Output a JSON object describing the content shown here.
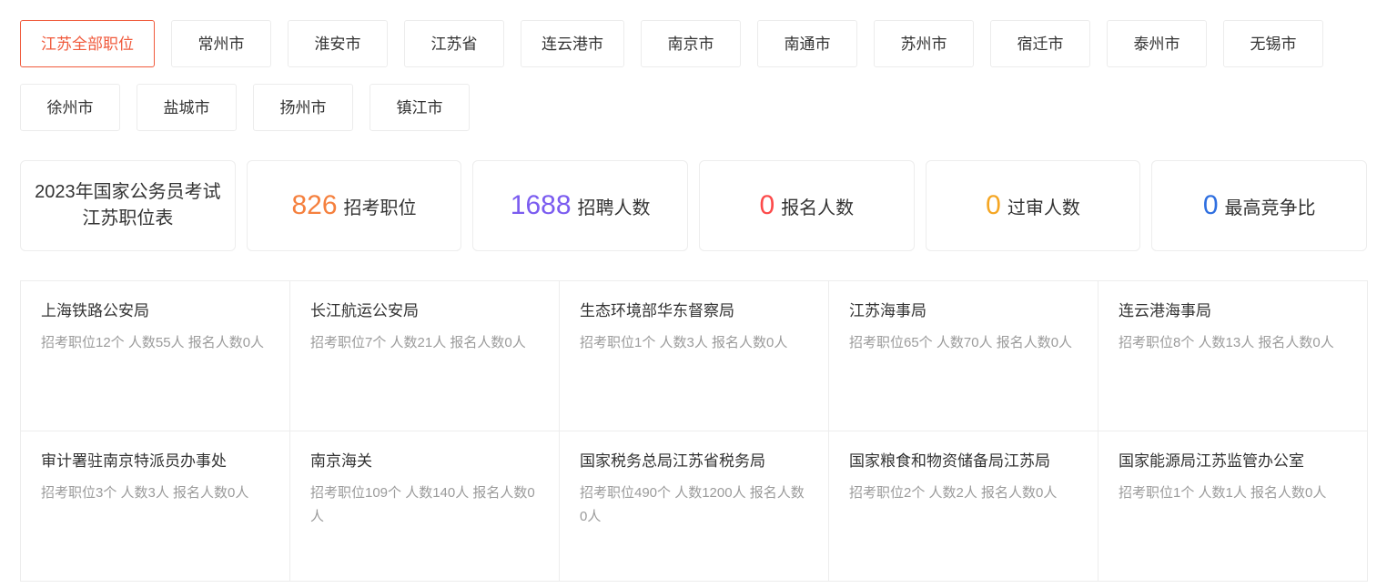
{
  "tabs": {
    "active_index": 0,
    "items": [
      {
        "label": "江苏全部职位",
        "active": true
      },
      {
        "label": "常州市",
        "active": false
      },
      {
        "label": "淮安市",
        "active": false
      },
      {
        "label": "江苏省",
        "active": false
      },
      {
        "label": "连云港市",
        "active": false
      },
      {
        "label": "南京市",
        "active": false
      },
      {
        "label": "南通市",
        "active": false
      },
      {
        "label": "苏州市",
        "active": false
      },
      {
        "label": "宿迁市",
        "active": false
      },
      {
        "label": "泰州市",
        "active": false
      },
      {
        "label": "无锡市",
        "active": false
      },
      {
        "label": "徐州市",
        "active": false
      },
      {
        "label": "盐城市",
        "active": false
      },
      {
        "label": "扬州市",
        "active": false
      },
      {
        "label": "镇江市",
        "active": false
      }
    ]
  },
  "stats": {
    "title": "2023年国家公务员考试江苏职位表",
    "cards": [
      {
        "value": "826",
        "label": "招考职位",
        "color": "#f5803e"
      },
      {
        "value": "1688",
        "label": "招聘人数",
        "color": "#7b5cf0"
      },
      {
        "value": "0",
        "label": "报名人数",
        "color": "#fc4a4a"
      },
      {
        "value": "0",
        "label": "过审人数",
        "color": "#f5a623"
      },
      {
        "value": "0",
        "label": "最高竞争比",
        "color": "#2f6fe0"
      }
    ]
  },
  "agencies": [
    {
      "name": "上海铁路公安局",
      "meta": "招考职位12个 人数55人 报名人数0人"
    },
    {
      "name": "长江航运公安局",
      "meta": "招考职位7个 人数21人 报名人数0人"
    },
    {
      "name": "生态环境部华东督察局",
      "meta": "招考职位1个 人数3人 报名人数0人"
    },
    {
      "name": "江苏海事局",
      "meta": "招考职位65个 人数70人 报名人数0人"
    },
    {
      "name": "连云港海事局",
      "meta": "招考职位8个 人数13人 报名人数0人"
    },
    {
      "name": "审计署驻南京特派员办事处",
      "meta": "招考职位3个 人数3人 报名人数0人"
    },
    {
      "name": "南京海关",
      "meta": "招考职位109个 人数140人 报名人数0人"
    },
    {
      "name": "国家税务总局江苏省税务局",
      "meta": "招考职位490个 人数1200人 报名人数0人"
    },
    {
      "name": "国家粮食和物资储备局江苏局",
      "meta": "招考职位2个 人数2人 报名人数0人"
    },
    {
      "name": "国家能源局江苏监管办公室",
      "meta": "招考职位1个 人数1人 报名人数0人"
    }
  ],
  "theme": {
    "active_tab_color": "#f05a3c",
    "border_color": "#ededed",
    "text_color": "#333333",
    "muted_text_color": "#9b9b9b"
  }
}
